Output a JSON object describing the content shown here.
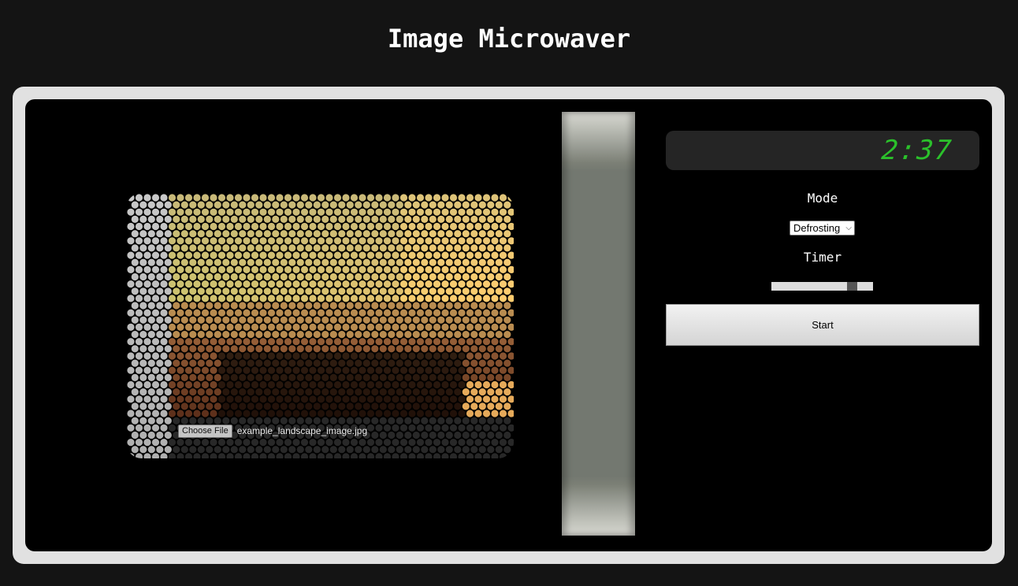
{
  "app": {
    "title": "Image Microwaver"
  },
  "display": {
    "time": "2:37",
    "color": "#2bc12b"
  },
  "controls": {
    "mode_label": "Mode",
    "mode_selected": "Defrosting",
    "timer_label": "Timer",
    "timer_value_fraction": 0.83,
    "start_label": "Start"
  },
  "file_input": {
    "button_label": "Choose File",
    "file_name": "example_landscape_image.jpg"
  },
  "icons": {
    "select_chevron": "chevron-down-icon"
  }
}
